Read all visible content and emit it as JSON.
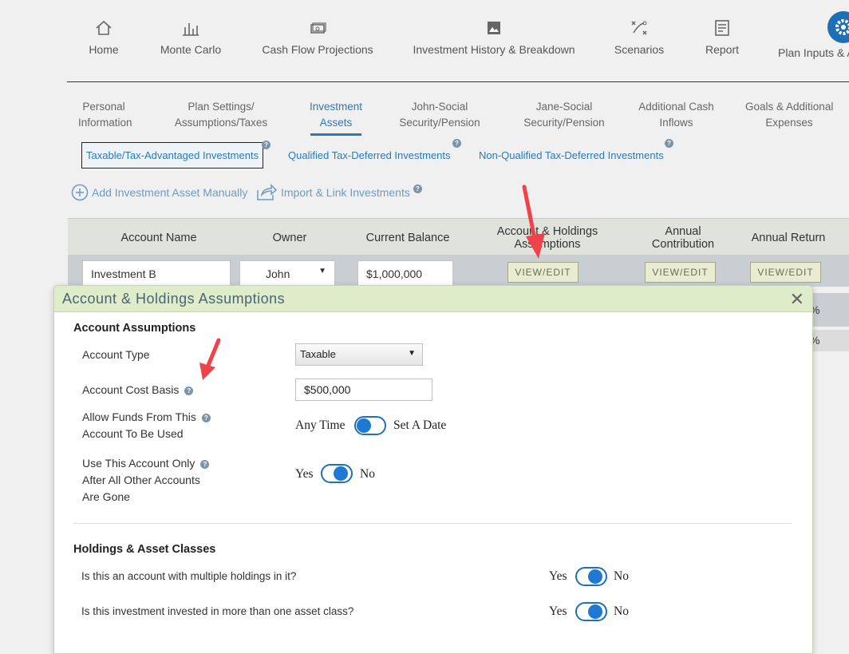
{
  "nav": {
    "items": [
      {
        "label": "Home",
        "icon": "home-icon"
      },
      {
        "label": "Monte Carlo",
        "icon": "bar-chart-icon"
      },
      {
        "label": "Cash Flow Projections",
        "icon": "cash-icon"
      },
      {
        "label": "Investment History & Breakdown",
        "icon": "image-icon"
      },
      {
        "label": "Scenarios",
        "icon": "strategy-icon"
      },
      {
        "label": "Report",
        "icon": "report-icon"
      },
      {
        "label": "Plan Inputs & A",
        "icon": "gear-icon"
      }
    ]
  },
  "subtabs": [
    {
      "line1": "Personal",
      "line2": "Information"
    },
    {
      "line1": "Plan Settings/",
      "line2": "Assumptions/Taxes"
    },
    {
      "line1": "Investment",
      "line2": "Assets"
    },
    {
      "line1": "John-Social",
      "line2": "Security/Pension"
    },
    {
      "line1": "Jane-Social",
      "line2": "Security/Pension"
    },
    {
      "line1": "Additional Cash",
      "line2": "Inflows"
    },
    {
      "line1": "Goals & Additional",
      "line2": "Expenses"
    }
  ],
  "inv_tabs": [
    "Taxable/Tax-Advantaged Investments",
    "Qualified Tax-Deferred Investments",
    "Non-Qualified Tax-Deferred Investments"
  ],
  "actions": {
    "add_manual": "Add Investment Asset Manually",
    "import_link": "Import & Link Investments"
  },
  "table": {
    "headers": {
      "account_name": "Account Name",
      "owner": "Owner",
      "current_balance": "Current Balance",
      "holdings_line1": "Account & Holdings",
      "holdings_line2": "Assumptions",
      "contribution_line1": "Annual",
      "contribution_line2": "Contribution",
      "annual_return": "Annual Return"
    },
    "row": {
      "account_name": "Investment B",
      "owner": "John",
      "balance": "$1,000,000",
      "view_edit": "VIEW/EDIT"
    },
    "clipped_cells": [
      "%",
      "%"
    ]
  },
  "modal": {
    "title": "Account & Holdings Assumptions",
    "section1": "Account Assumptions",
    "account_type_label": "Account Type",
    "account_type_value": "Taxable",
    "cost_basis_label": "Account Cost Basis",
    "cost_basis_value": "$500,000",
    "allow_funds_line1": "Allow Funds From This",
    "allow_funds_line2": "Account To Be Used",
    "allow_funds_left": "Any Time",
    "allow_funds_right": "Set A Date",
    "use_last_line1": "Use This Account Only",
    "use_last_line2": "After All Other Accounts",
    "use_last_line3": "Are Gone",
    "section2": "Holdings & Asset Classes",
    "multi_holdings_label": "Is this an account with multiple holdings in it?",
    "multi_asset_label": "Is this investment invested in more than one asset class?",
    "yes": "Yes",
    "no": "No"
  },
  "colors": {
    "accent": "#1f6fb6",
    "annotation_arrow": "#f0424a",
    "modal_header": "#dfecc9"
  }
}
